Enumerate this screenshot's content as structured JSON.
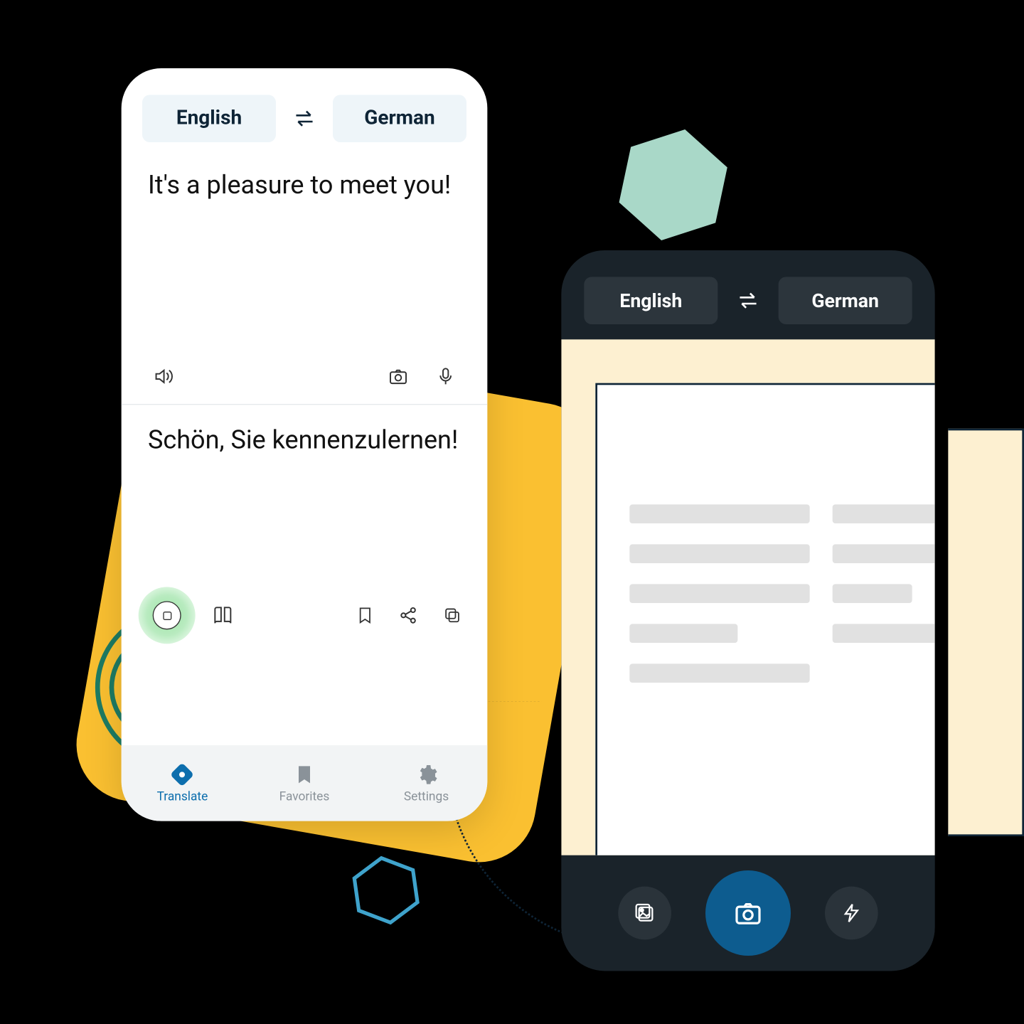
{
  "left_phone": {
    "source_lang": "English",
    "target_lang": "German",
    "input_text": "It's a pleasure to meet you!",
    "output_text": "Schön, Sie kennenzulernen!",
    "tabs": {
      "translate": "Translate",
      "favorites": "Favorites",
      "settings": "Settings"
    },
    "active_tab": "translate"
  },
  "right_phone": {
    "source_lang": "English",
    "target_lang": "German"
  },
  "colors": {
    "accent_yellow": "#FAC031",
    "accent_teal": "#A9D8C8",
    "accent_blue": "#0D6EAD",
    "dark_bg": "#1A232A"
  }
}
